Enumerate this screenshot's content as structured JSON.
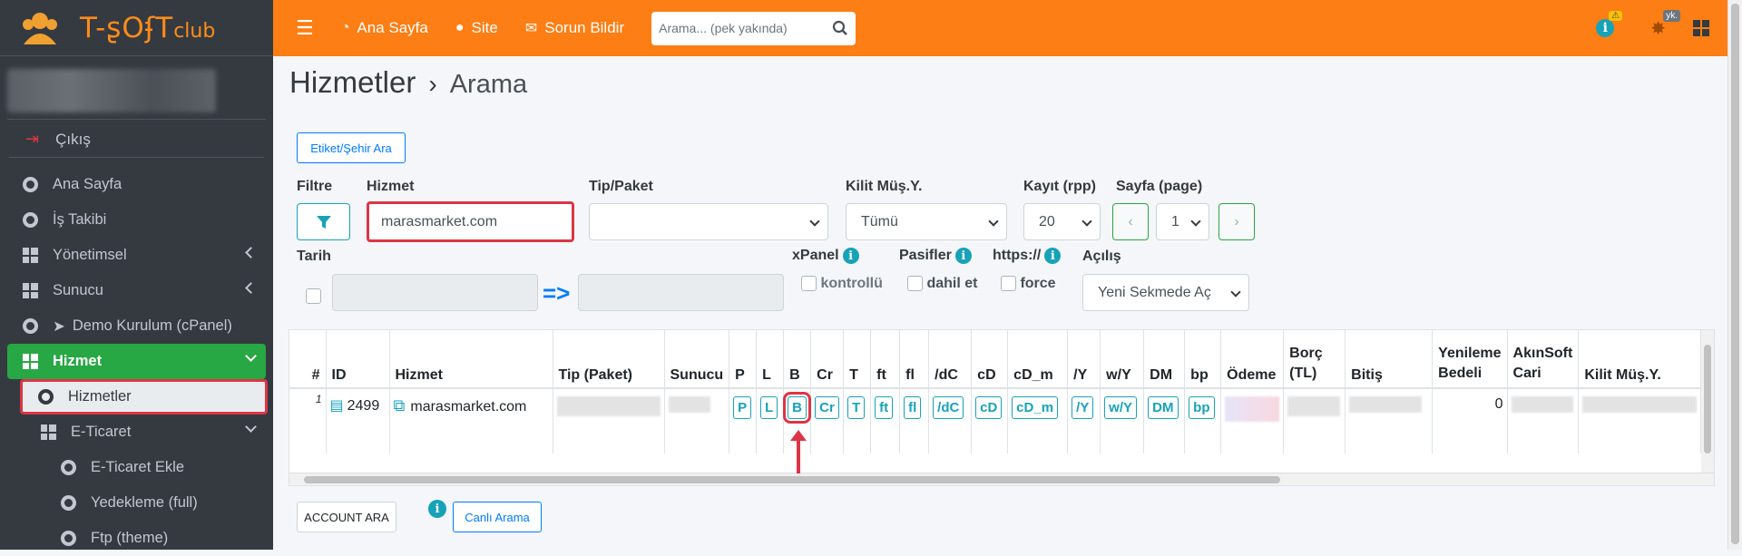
{
  "brand": {
    "name": "T-softclub",
    "accent": "#fd7e14"
  },
  "sidebar": {
    "logout": "Çıkış",
    "items": [
      {
        "label": "Ana Sayfa"
      },
      {
        "label": "İş Takibi"
      },
      {
        "label": "Yönetimsel"
      },
      {
        "label": "Sunucu"
      },
      {
        "label": "Demo Kurulum (cPanel)"
      },
      {
        "label": "Hizmet"
      },
      {
        "label": "Hizmetler"
      },
      {
        "label": "E-Ticaret"
      },
      {
        "label": "E-Ticaret Ekle"
      },
      {
        "label": "Yedekleme (full)"
      },
      {
        "label": "Ftp (theme)"
      }
    ]
  },
  "topbar": {
    "home": "Ana Sayfa",
    "site": "Site",
    "report": "Sorun Bildir",
    "search_placeholder": "Arama... (pek yakında)",
    "badge_yk": "yk."
  },
  "page": {
    "title": "Hizmetler",
    "crumb": "Arama"
  },
  "filters": {
    "etiket_btn": "Etiket/Şehir Ara",
    "filtre_label": "Filtre",
    "hizmet_label": "Hizmet",
    "hizmet_value": "marasmarket.com",
    "tip_label": "Tip/Paket",
    "kilit_label": "Kilit Müş.Y.",
    "kilit_value": "Tümü",
    "kayit_label": "Kayıt (rpp)",
    "kayit_value": "20",
    "sayfa_label": "Sayfa (page)",
    "sayfa_value": "1",
    "tarih_label": "Tarih",
    "tarih_arrow": "=>",
    "xpanel_label": "xPanel",
    "xpanel_opt": "kontrollü",
    "pasif_label": "Pasifler",
    "pasif_opt": "dahil et",
    "https_label": "https://",
    "https_opt": "force",
    "acilis_label": "Açılış",
    "acilis_value": "Yeni Sekmede Aç"
  },
  "table": {
    "headers": [
      "#",
      "ID",
      "Hizmet",
      "Tip (Paket)",
      "Sunucu",
      "P",
      "L",
      "B",
      "Cr",
      "T",
      "ft",
      "fl",
      "/dC",
      "cD",
      "cD_m",
      "/Y",
      "w/Y",
      "DM",
      "bp",
      "Ödeme",
      "Borç (TL)",
      "Bitiş",
      "Yenileme Bedeli",
      "AkınSoft Cari",
      "Kilit Müş.Y."
    ],
    "row": {
      "num": "1",
      "id": "2499",
      "hizmet": "marasmarket.com",
      "tags": [
        "P",
        "L",
        "B",
        "Cr",
        "T",
        "ft",
        "fl",
        "/dC",
        "cD",
        "cD_m",
        "/Y",
        "w/Y",
        "DM",
        "bp"
      ],
      "yenileme": "0"
    }
  },
  "bottom": {
    "account_btn": "ACCOUNT ARA",
    "canli_btn": "Canlı Arama"
  }
}
